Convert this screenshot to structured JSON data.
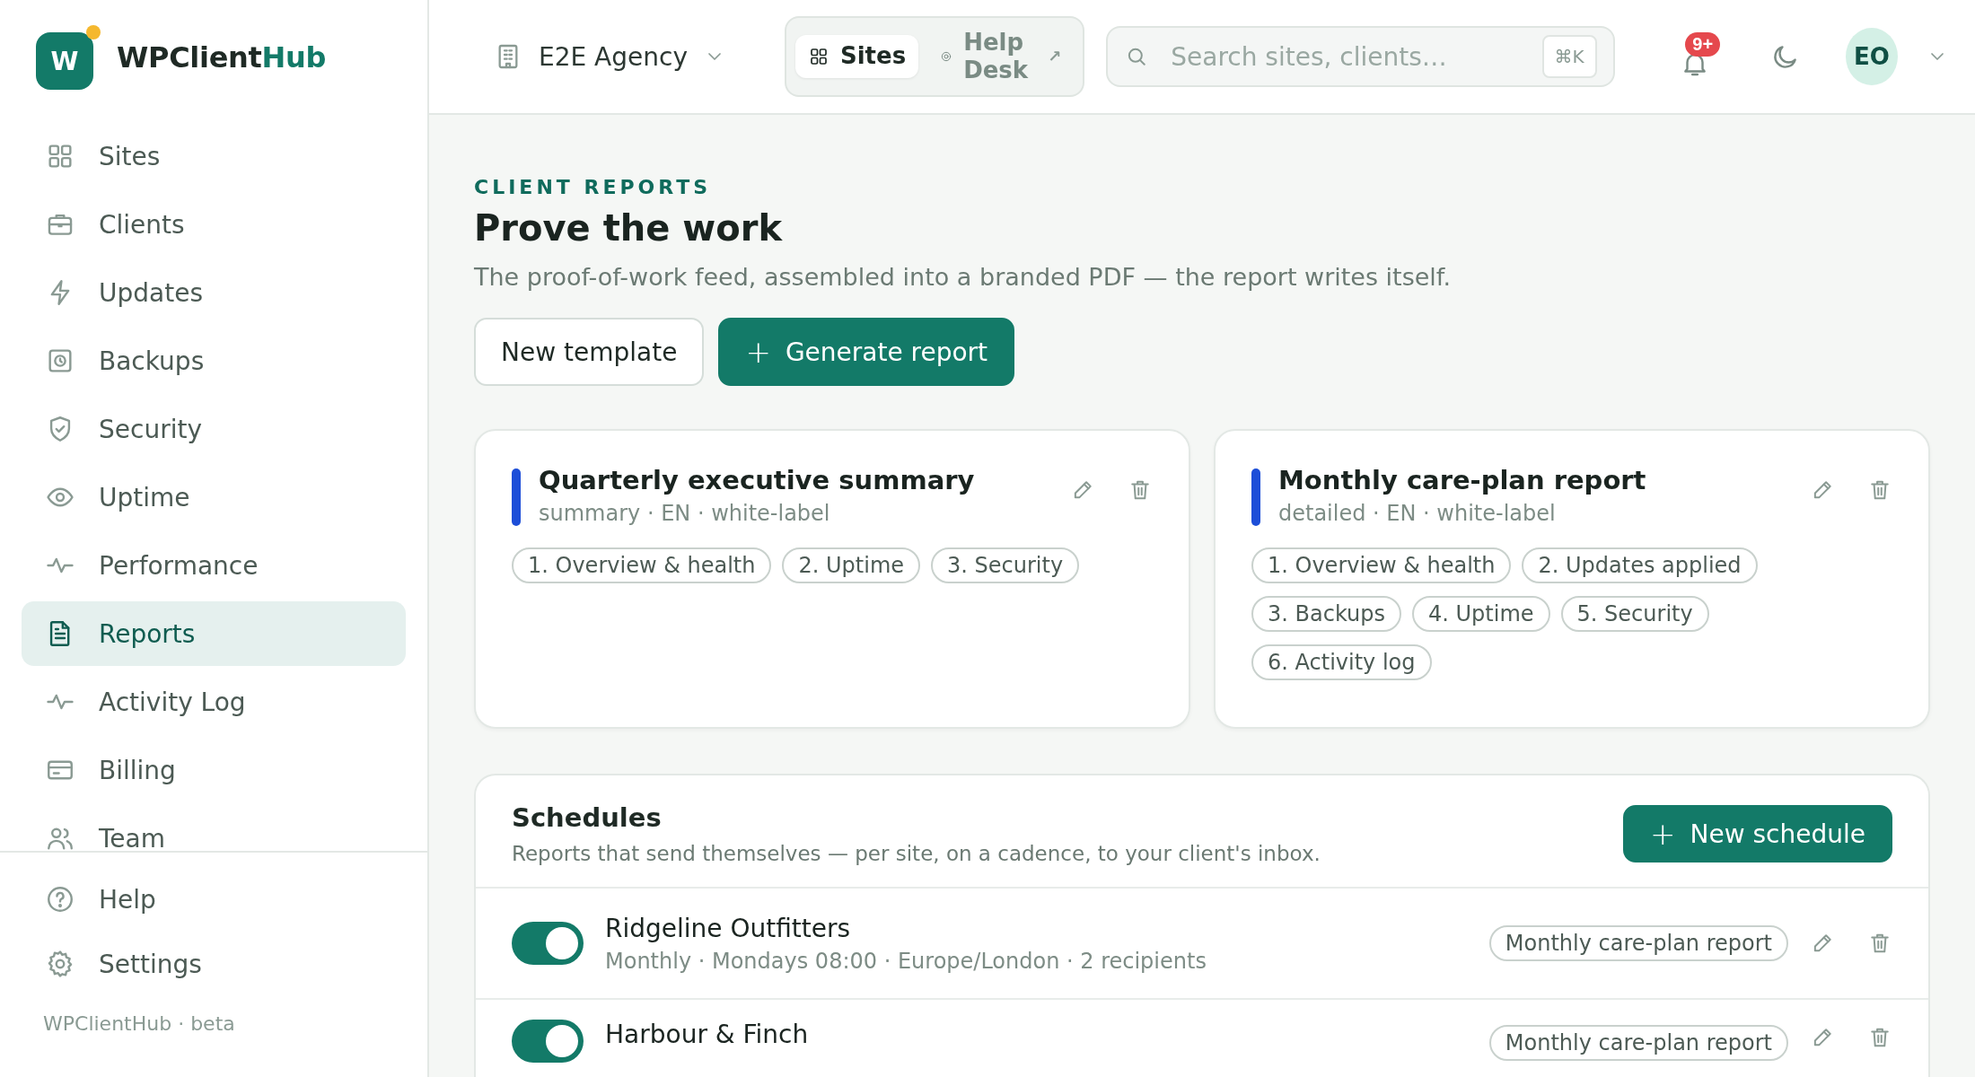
{
  "brand": {
    "logo_letter": "W",
    "name_dark": "WPClient",
    "name_accent": "Hub",
    "has_dot": true
  },
  "sidebar": {
    "items": [
      {
        "label": "Sites",
        "selected": false
      },
      {
        "label": "Clients",
        "selected": false
      },
      {
        "label": "Updates",
        "selected": false
      },
      {
        "label": "Backups",
        "selected": false
      },
      {
        "label": "Security",
        "selected": false
      },
      {
        "label": "Uptime",
        "selected": false
      },
      {
        "label": "Performance",
        "selected": false
      },
      {
        "label": "Reports",
        "selected": true
      },
      {
        "label": "Activity Log",
        "selected": false
      },
      {
        "label": "Billing",
        "selected": false
      },
      {
        "label": "Team",
        "selected": false
      }
    ],
    "footer_items": [
      {
        "label": "Help"
      },
      {
        "label": "Settings"
      }
    ],
    "version": "WPClientHub · beta"
  },
  "topbar": {
    "org": "E2E Agency",
    "switch": [
      {
        "label": "Sites",
        "selected": true
      },
      {
        "label": "Help Desk",
        "selected": false,
        "suffix": "↗"
      }
    ],
    "search": {
      "placeholder": "Search sites, clients…",
      "shortcut": "⌘K"
    },
    "notifications": "9+",
    "avatar": "EO"
  },
  "page": {
    "eyebrow": "CLIENT REPORTS",
    "title": "Prove the work",
    "subtitle": "The proof-of-work feed, assembled into a branded PDF — the report writes itself.",
    "buttons": [
      {
        "label": "New template",
        "kind": "secondary"
      },
      {
        "label": "Generate report",
        "kind": "primary",
        "icon": "+"
      }
    ]
  },
  "templates": [
    {
      "title": "Quarterly executive summary",
      "meta": "summary · EN · white-label",
      "color": "#1d4ed8",
      "sections": [
        "1. Overview & health",
        "2. Uptime",
        "3. Security"
      ]
    },
    {
      "title": "Monthly care-plan report",
      "meta": "detailed · EN · white-label",
      "color": "#1d4ed8",
      "sections": [
        "1. Overview & health",
        "2. Updates applied",
        "3. Backups",
        "4. Uptime",
        "5. Security",
        "6. Activity log"
      ]
    }
  ],
  "schedules": {
    "title": "Schedules",
    "subtitle": "Reports that send themselves — per site, on a cadence, to your client's inbox.",
    "button": {
      "label": "New schedule",
      "icon": "+"
    },
    "rows": [
      {
        "site": "Ridgeline Outfitters",
        "detail": "Monthly · Mondays 08:00 · Europe/London · 2 recipients",
        "template": "Monthly care-plan report",
        "on": true
      },
      {
        "site": "Harbour & Finch",
        "template": "Monthly care-plan report",
        "on": true
      }
    ]
  }
}
